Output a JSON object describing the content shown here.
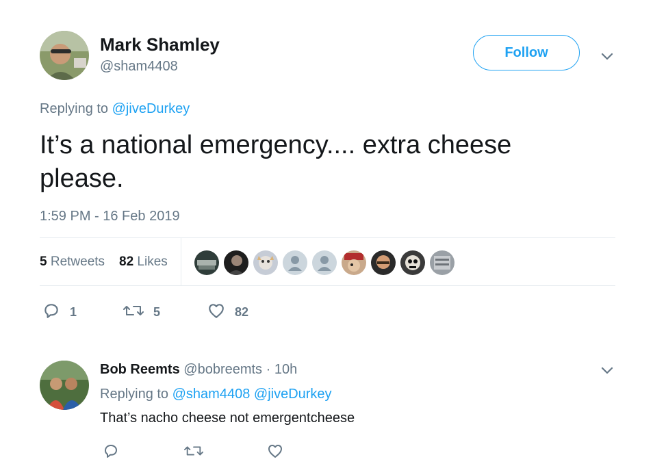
{
  "tweet": {
    "author_name": "Mark Shamley",
    "author_handle": "@sham4408",
    "follow_label": "Follow",
    "replying_prefix": "Replying to",
    "replying_to": "@jiveDurkey",
    "text": "It’s a national emergency.... extra cheese please.",
    "timestamp": "1:59 PM - 16 Feb 2019",
    "stats": {
      "retweets_count": "5",
      "retweets_label": "Retweets",
      "likes_count": "82",
      "likes_label": "Likes"
    },
    "actions": {
      "reply_count": "1",
      "retweet_count": "5",
      "like_count": "82"
    }
  },
  "reply": {
    "author_name": "Bob Reemts",
    "author_handle": "@bobreemts",
    "separator": "·",
    "time": "10h",
    "replying_prefix": "Replying to",
    "replying_to_1": "@sham4408",
    "replying_to_2": "@jiveDurkey",
    "text": "That’s nacho cheese not emergentcheese"
  },
  "colors": {
    "accent": "#1da1f2",
    "muted": "#657786",
    "text": "#14171a",
    "divider": "#e6ecf0"
  },
  "icons": [
    "chevron-down-icon",
    "reply-icon",
    "retweet-icon",
    "heart-icon"
  ]
}
